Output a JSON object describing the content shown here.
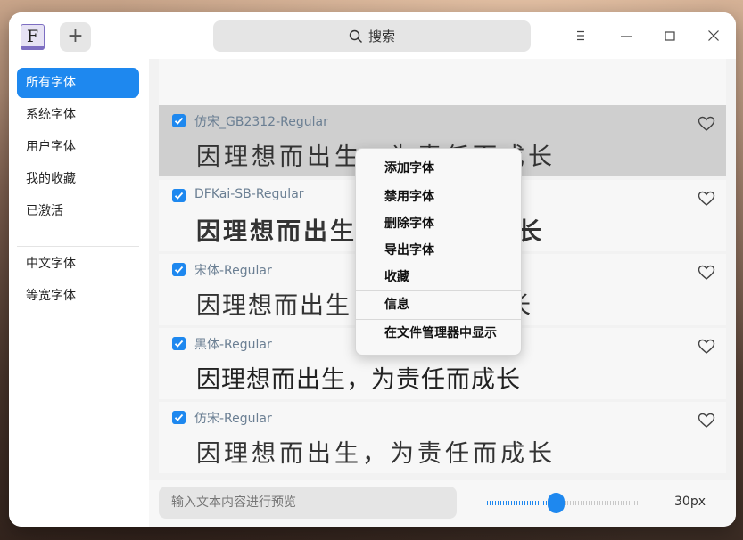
{
  "toolbar": {
    "logo_letter": "F",
    "add_label": "+",
    "search_placeholder": "搜索",
    "search_icon": "search-icon",
    "menu_icon": "hamburger-menu-icon",
    "minimize_icon": "minimize-icon",
    "maximize_icon": "maximize-icon",
    "close_icon": "close-icon"
  },
  "sidebar": {
    "groups": [
      {
        "items": [
          {
            "label": "所有字体",
            "active": true
          },
          {
            "label": "系统字体"
          },
          {
            "label": "用户字体"
          },
          {
            "label": "我的收藏"
          },
          {
            "label": "已激活"
          }
        ]
      },
      {
        "items": [
          {
            "label": "中文字体"
          },
          {
            "label": "等宽字体"
          }
        ]
      }
    ]
  },
  "fonts": [
    {
      "name": "仿宋_GB2312-Regular",
      "preview": "因理想而出生，为责任而成长",
      "checked": true,
      "favorite": false,
      "selected": true
    },
    {
      "name": "DFKai-SB-Regular",
      "preview": "因理想而出生，为责任而成长",
      "checked": true,
      "favorite": false
    },
    {
      "name": "宋体-Regular",
      "preview": "因理想而出生，为责任而成长",
      "checked": true,
      "favorite": false
    },
    {
      "name": "黑体-Regular",
      "preview": "因理想而出生，为责任而成长",
      "checked": true,
      "favorite": false
    },
    {
      "name": "仿宋-Regular",
      "preview": "因理想而出生，为责任而成长",
      "checked": true,
      "favorite": false
    }
  ],
  "context_menu": {
    "items": [
      "添加字体",
      "禁用字体",
      "删除字体",
      "导出字体",
      "收藏",
      "信息",
      "在文件管理器中显示"
    ]
  },
  "bottombar": {
    "preview_placeholder": "输入文本内容进行预览",
    "font_size_value": 30,
    "font_size_label": "30px",
    "slider_fraction": 0.45
  },
  "colors": {
    "accent": "#1e88ef",
    "selected_row": "#cfcfcf"
  }
}
